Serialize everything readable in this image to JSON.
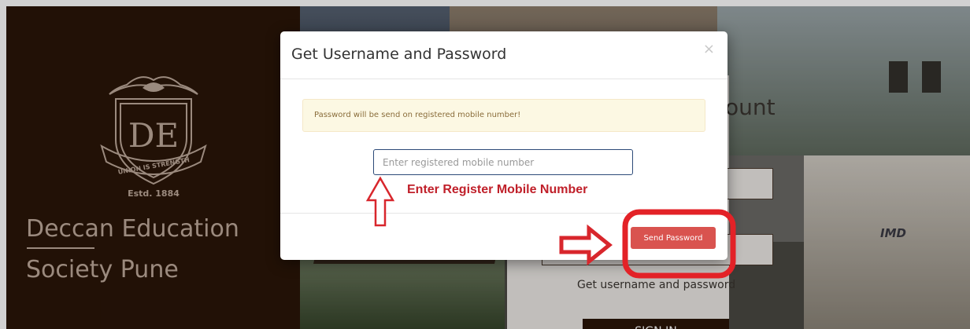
{
  "background": {
    "org_name_line1": "Deccan Education",
    "org_name_line2": "Society Pune",
    "logo_motto": "UNION IS STRENGTH",
    "logo_monogram": "DE",
    "logo_estd": "Estd. 1884",
    "login_title_partial": "ount",
    "forgot_link": "Get username and password",
    "signin_partial": "SIGN IN",
    "photo_sign_partial": "IMD"
  },
  "modal": {
    "title": "Get Username and Password",
    "close_symbol": "×",
    "alert_text": "Password will be send on registered mobile number!",
    "mobile_placeholder": "Enter registered mobile number",
    "mobile_value": "",
    "send_button_label": "Send Password"
  },
  "annotations": {
    "input_hint": "Enter Register Mobile Number"
  },
  "colors": {
    "panel_brown": "#2a1508",
    "send_button": "#d9534f",
    "annotation_red": "#c0202a",
    "alert_bg": "#fcf8e3"
  },
  "icons": {
    "close": "close-icon",
    "up_arrow": "up-arrow-annotation-icon",
    "right_arrow": "right-arrow-annotation-icon"
  }
}
